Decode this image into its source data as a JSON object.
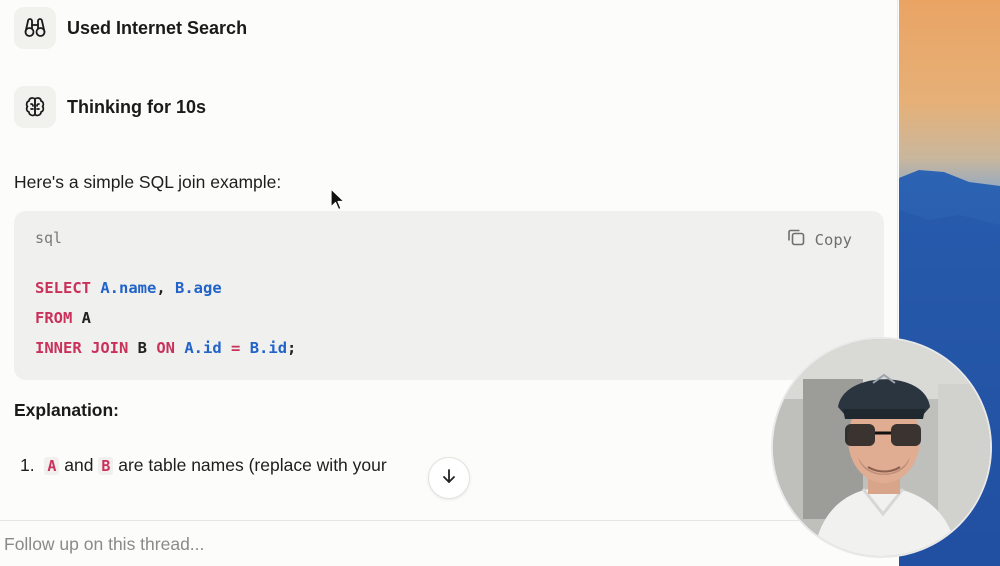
{
  "steps": [
    {
      "label": "Used Internet Search",
      "icon": "binoculars-icon"
    },
    {
      "label": "Thinking for 10s",
      "icon": "brain-icon"
    }
  ],
  "message": {
    "intro": "Here's a simple SQL join example:",
    "code_block": {
      "language": "sql",
      "copy_label": "Copy",
      "lines": [
        [
          {
            "t": "SELECT",
            "k": "kw"
          },
          {
            "t": " "
          },
          {
            "t": "A.name",
            "k": "id"
          },
          {
            "t": ", "
          },
          {
            "t": "B.age",
            "k": "id"
          }
        ],
        [
          {
            "t": "FROM",
            "k": "kw"
          },
          {
            "t": " A"
          }
        ],
        [
          {
            "t": "INNER JOIN",
            "k": "kw"
          },
          {
            "t": " B "
          },
          {
            "t": "ON",
            "k": "kw"
          },
          {
            "t": " "
          },
          {
            "t": "A.id",
            "k": "id"
          },
          {
            "t": " "
          },
          {
            "t": "=",
            "k": "kw"
          },
          {
            "t": " "
          },
          {
            "t": "B.id",
            "k": "id"
          },
          {
            "t": ";"
          }
        ]
      ]
    },
    "explanation_heading": "Explanation:",
    "list_item_1": {
      "number": "1.",
      "code_a": "A",
      "and": "and",
      "code_b": "B",
      "rest": "are table names (replace with your"
    }
  },
  "scroll_button_icon": "arrow-down-icon",
  "followup": {
    "placeholder": "Follow up on this thread..."
  },
  "colors": {
    "keyword": "#c9315b",
    "identifier": "#2263c9",
    "code_bg": "#f0f0ee",
    "page_bg": "#fcfcfa"
  }
}
